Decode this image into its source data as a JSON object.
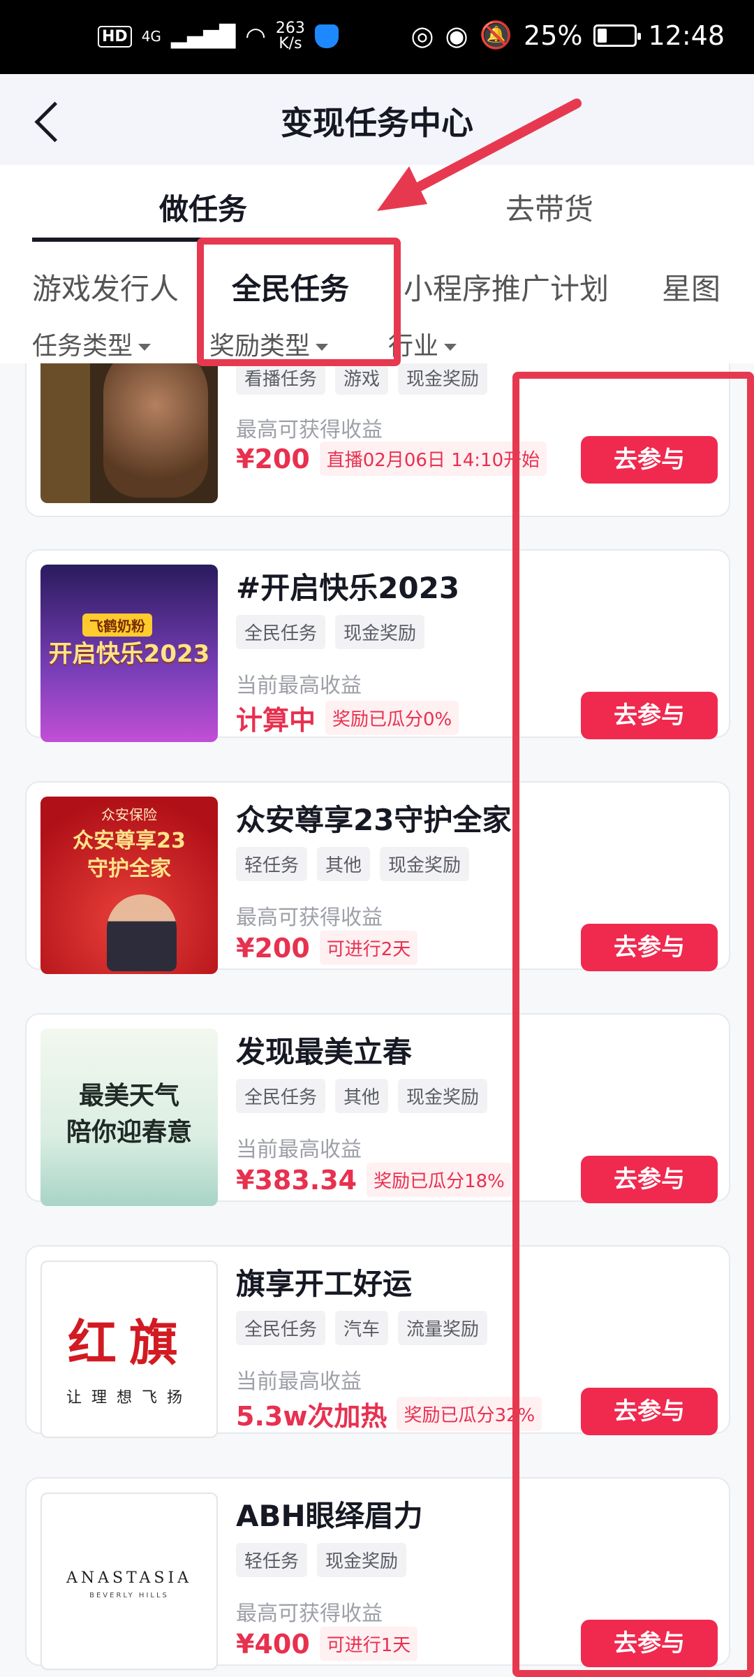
{
  "status_bar": {
    "hd": "HD",
    "signal": "4G",
    "net_speed_value": "263",
    "net_speed_unit": "K/s",
    "battery": "25%",
    "battery_level": 0.25,
    "time": "12:48"
  },
  "header": {
    "title": "变现任务中心"
  },
  "top_tabs": [
    {
      "label": "做任务",
      "active": true
    },
    {
      "label": "去带货",
      "active": false
    }
  ],
  "sub_tabs": [
    {
      "label": "游戏发行人",
      "active": false
    },
    {
      "label": "全民任务",
      "active": true
    },
    {
      "label": "小程序推广计划",
      "active": false
    },
    {
      "label": "星图",
      "active": false
    }
  ],
  "filters": [
    {
      "label": "任务类型"
    },
    {
      "label": "奖励类型"
    },
    {
      "label": "行业"
    }
  ],
  "tasks": [
    {
      "title": "",
      "tags": [
        "看播任务",
        "游戏",
        "现金奖励"
      ],
      "earn_label": "最高可获得收益",
      "earn_value": "¥200",
      "badge": "直播02月06日 14:10开始",
      "cta": "去参与"
    },
    {
      "title": "#开启快乐2023",
      "tags": [
        "全民任务",
        "现金奖励"
      ],
      "earn_label": "当前最高收益",
      "earn_value": "计算中",
      "badge": "奖励已瓜分0%",
      "cta": "去参与",
      "thumb_text": "开启快乐2023",
      "thumb_top": "飞鹤奶粉"
    },
    {
      "title": "众安尊享23守护全家",
      "tags": [
        "轻任务",
        "其他",
        "现金奖励"
      ],
      "earn_label": "最高可获得收益",
      "earn_value": "¥200",
      "badge": "可进行2天",
      "cta": "去参与",
      "thumb_brand": "众安保险",
      "thumb_line1": "众安尊享23",
      "thumb_line2": "守护全家"
    },
    {
      "title": "发现最美立春",
      "tags": [
        "全民任务",
        "其他",
        "现金奖励"
      ],
      "earn_label": "当前最高收益",
      "earn_value": "¥383.34",
      "badge": "奖励已瓜分18%",
      "cta": "去参与",
      "thumb_line1": "最美天气",
      "thumb_line2": "陪你迎春意"
    },
    {
      "title": "旗享开工好运",
      "tags": [
        "全民任务",
        "汽车",
        "流量奖励"
      ],
      "earn_label": "当前最高收益",
      "earn_value": "5.3w次加热",
      "badge": "奖励已瓜分32%",
      "cta": "去参与",
      "thumb_big": "红旗",
      "thumb_small": "让理想飞扬"
    },
    {
      "title": "ABH眼绎眉力",
      "tags": [
        "轻任务",
        "现金奖励"
      ],
      "earn_label": "最高可获得收益",
      "earn_value": "¥400",
      "badge": "可进行1天",
      "cta": "去参与",
      "thumb_big": "ANASTASIA",
      "thumb_small": "BEVERLY HILLS"
    }
  ],
  "colors": {
    "accent": "#f0294f",
    "annotation": "#e63950"
  }
}
